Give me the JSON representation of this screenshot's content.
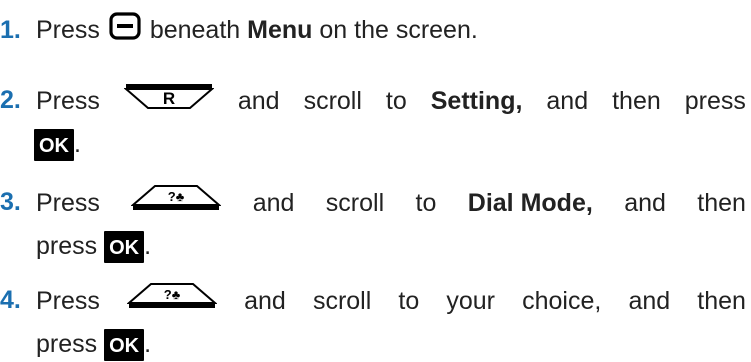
{
  "steps": [
    {
      "num": "1.",
      "parts": [
        "Press",
        "beneath",
        "Menu",
        "on the screen."
      ]
    },
    {
      "num": "2.",
      "parts": [
        "Press",
        "and",
        "scroll",
        "to",
        "Setting,",
        "and",
        "then",
        "press",
        "."
      ],
      "key_label": "R"
    },
    {
      "num": "3.",
      "parts": [
        "Press",
        "and",
        "scroll",
        "to",
        "Dial Mode,",
        "and",
        "then",
        "press",
        "."
      ]
    },
    {
      "num": "4.",
      "parts": [
        "Press",
        "and",
        "scroll",
        "to",
        "your",
        "choice,",
        "and",
        "then",
        "press",
        "."
      ]
    }
  ],
  "ok_label": "OK",
  "phonebook_key_label": "?♣",
  "colors": {
    "number": "#1b6fb0",
    "text": "#222222"
  },
  "icons": [
    "menu-softkey-icon",
    "redial-key-icon",
    "phonebook-key-icon",
    "ok-button-icon"
  ]
}
